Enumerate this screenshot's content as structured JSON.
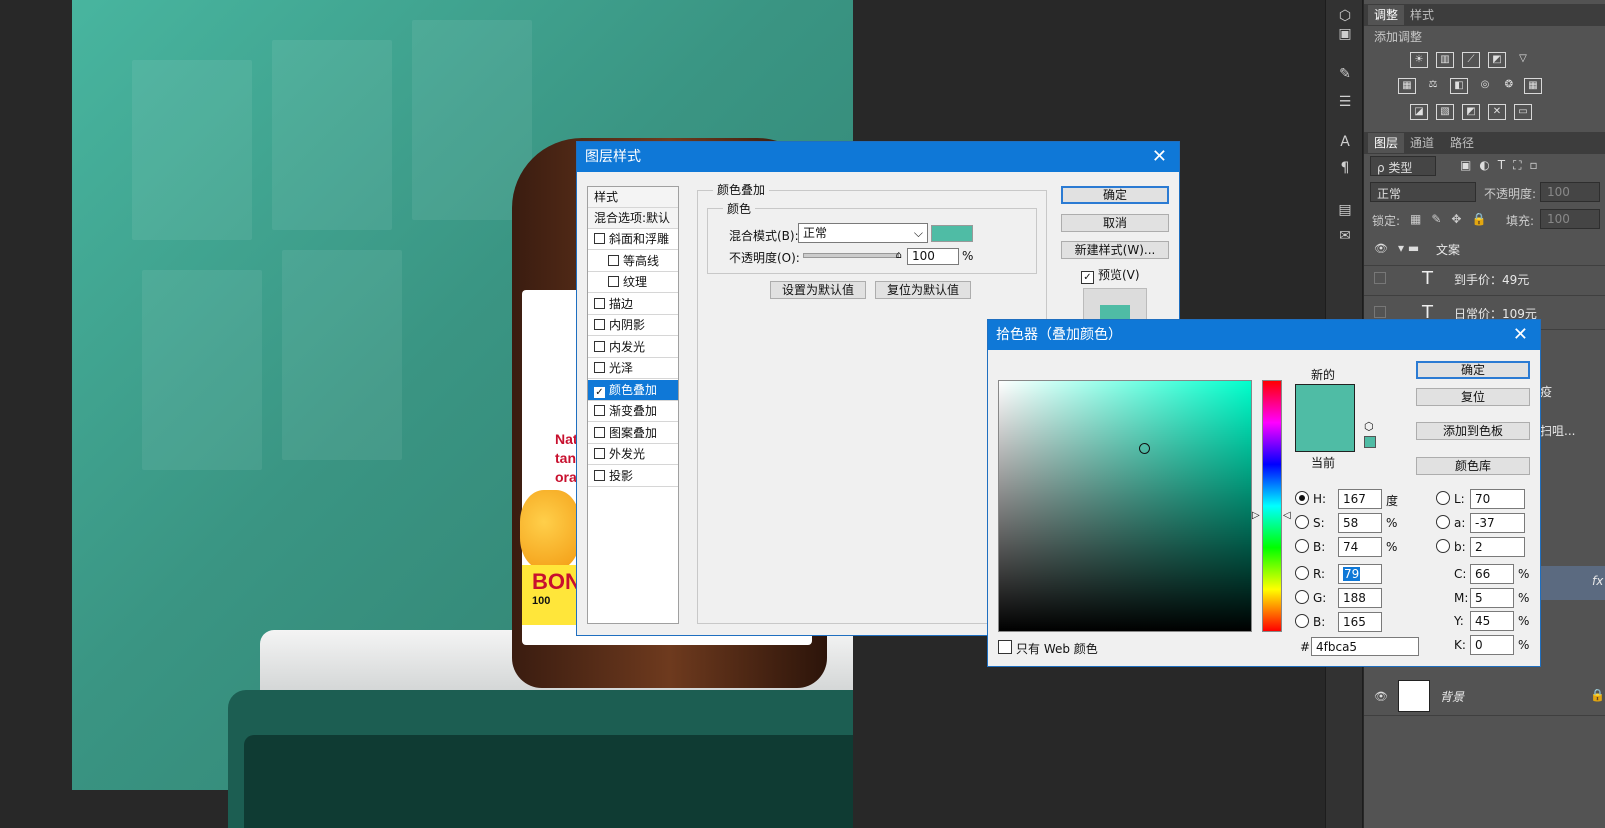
{
  "toolstrip": {
    "icons": [
      "cube-icon",
      "brush-settings-icon",
      "sliders-icon",
      "text-icon",
      "paragraph-icon",
      "panel-icon",
      "notes-icon"
    ]
  },
  "panel": {
    "tabs_top": [
      "调整",
      "样式"
    ],
    "add_adjustment": "添加调整",
    "tabs_layers": [
      "图层",
      "通道",
      "路径"
    ],
    "filter_kind": "ρ 类型",
    "blend_mode": "正常",
    "opacity_label": "不透明度:",
    "opacity_value": "100",
    "lock_label": "锁定:",
    "fill_label": "填充:",
    "fill_value": "100",
    "layers": [
      {
        "name": "文案",
        "type": "group"
      },
      {
        "name": "到手价：49元",
        "type": "text"
      },
      {
        "name": "日常价：109元",
        "type": "text"
      },
      {
        "name": "疫",
        "type": "partial"
      },
      {
        "name": "扫咀...",
        "type": "partial"
      },
      {
        "name": "fx",
        "type": "partial"
      },
      {
        "name": "背景",
        "type": "background"
      }
    ]
  },
  "layer_style": {
    "title": "图层样式",
    "styles_header": "样式",
    "blend_default": "混合选项:默认",
    "items": [
      {
        "label": "斜面和浮雕",
        "checked": false,
        "indent": false
      },
      {
        "label": "等高线",
        "checked": false,
        "indent": true
      },
      {
        "label": "纹理",
        "checked": false,
        "indent": true
      },
      {
        "label": "描边",
        "checked": false,
        "indent": false
      },
      {
        "label": "内阴影",
        "checked": false,
        "indent": false
      },
      {
        "label": "内发光",
        "checked": false,
        "indent": false
      },
      {
        "label": "光泽",
        "checked": false,
        "indent": false
      },
      {
        "label": "颜色叠加",
        "checked": true,
        "indent": false,
        "selected": true
      },
      {
        "label": "渐变叠加",
        "checked": false,
        "indent": false
      },
      {
        "label": "图案叠加",
        "checked": false,
        "indent": false
      },
      {
        "label": "外发光",
        "checked": false,
        "indent": false
      },
      {
        "label": "投影",
        "checked": false,
        "indent": false
      }
    ],
    "section_title": "颜色叠加",
    "color_group": "颜色",
    "blend_mode_label": "混合模式(B):",
    "blend_mode_value": "正常",
    "opacity_label": "不透明度(O):",
    "opacity_value": "100",
    "percent": "%",
    "set_default": "设置为默认值",
    "reset_default": "复位为默认值",
    "ok": "确定",
    "cancel": "取消",
    "new_style": "新建样式(W)...",
    "preview": "预览(V)",
    "overlay_color": "#4fbca5"
  },
  "picker": {
    "title": "拾色器（叠加颜色）",
    "new_label": "新的",
    "current_label": "当前",
    "ok": "确定",
    "reset": "复位",
    "add_swatch": "添加到色板",
    "color_libraries": "颜色库",
    "web_only": "只有 Web 颜色",
    "hsb": [
      {
        "label": "H:",
        "value": "167",
        "unit": "度",
        "on": true
      },
      {
        "label": "S:",
        "value": "58",
        "unit": "%",
        "on": false
      },
      {
        "label": "B:",
        "value": "74",
        "unit": "%",
        "on": false
      }
    ],
    "rgb": [
      {
        "label": "R:",
        "value": "79"
      },
      {
        "label": "G:",
        "value": "188"
      },
      {
        "label": "B:",
        "value": "165"
      }
    ],
    "lab": [
      {
        "label": "L:",
        "value": "70"
      },
      {
        "label": "a:",
        "value": "-37"
      },
      {
        "label": "b:",
        "value": "2"
      }
    ],
    "cmyk": [
      {
        "label": "C:",
        "value": "66",
        "unit": "%"
      },
      {
        "label": "M:",
        "value": "5",
        "unit": "%"
      },
      {
        "label": "Y:",
        "value": "45",
        "unit": "%"
      },
      {
        "label": "K:",
        "value": "0",
        "unit": "%"
      }
    ],
    "hex_label": "#",
    "hex_value": "4fbca5",
    "new_color": "#4fbca5",
    "current_color": "#4fbca5"
  },
  "canvas_text": {
    "bottle_lines": [
      "Nat",
      "tan",
      "ora"
    ],
    "bon": "BON",
    "bon_sub": "100"
  }
}
